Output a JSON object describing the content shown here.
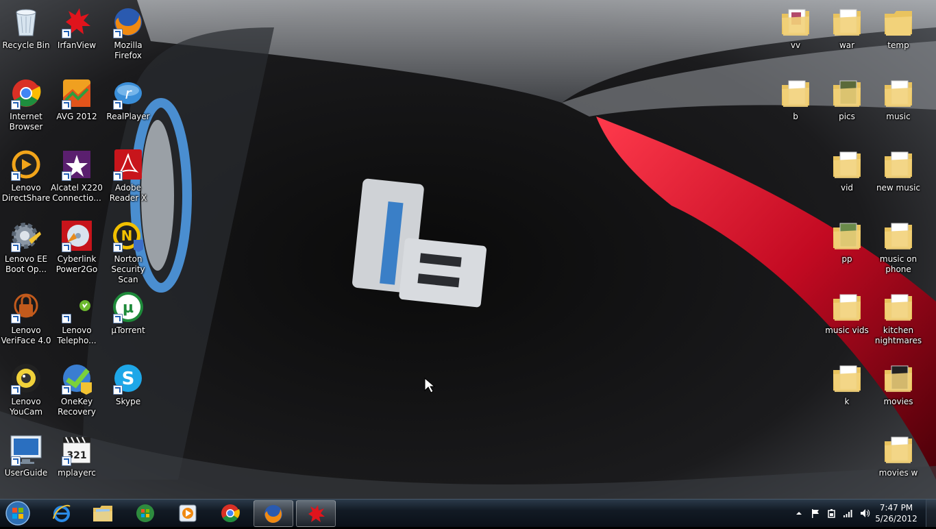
{
  "desktop": {
    "left_icons": [
      {
        "label": "Recycle Bin",
        "icon": "recycle-bin-icon"
      },
      {
        "label": "IrfanView",
        "icon": "irfanview-icon"
      },
      {
        "label": "Mozilla Firefox",
        "icon": "firefox-icon"
      },
      {
        "label": "Internet Browser",
        "icon": "chrome-icon"
      },
      {
        "label": "AVG 2012",
        "icon": "avg-icon"
      },
      {
        "label": "RealPlayer",
        "icon": "realplayer-icon"
      },
      {
        "label": "Lenovo DirectShare",
        "icon": "directshare-icon"
      },
      {
        "label": "Alcatel X220 Connectio...",
        "icon": "alcatel-icon"
      },
      {
        "label": "Adobe Reader X",
        "icon": "adobe-reader-icon"
      },
      {
        "label": "Lenovo EE Boot Op...",
        "icon": "gear-icon"
      },
      {
        "label": "Cyberlink Power2Go",
        "icon": "power2go-icon"
      },
      {
        "label": "Norton Security Scan",
        "icon": "norton-icon"
      },
      {
        "label": "Lenovo VeriFace 4.0",
        "icon": "veriface-icon"
      },
      {
        "label": "Lenovo Telepho...",
        "icon": "telephony-icon"
      },
      {
        "label": "µTorrent",
        "icon": "utorrent-icon"
      },
      {
        "label": "Lenovo YouCam",
        "icon": "webcam-icon"
      },
      {
        "label": "OneKey Recovery",
        "icon": "onekey-recovery-icon"
      },
      {
        "label": "Skype",
        "icon": "skype-icon"
      },
      {
        "label": "UserGuide",
        "icon": "lenovo-monitor-icon"
      },
      {
        "label": "mplayerc",
        "icon": "clapperboard-icon"
      }
    ],
    "right_icons": [
      {
        "label": "vv",
        "icon": "folder-icon"
      },
      {
        "label": "war",
        "icon": "folder-icon"
      },
      {
        "label": "temp",
        "icon": "folder-icon"
      },
      {
        "label": "b",
        "icon": "folder-icon"
      },
      {
        "label": "pics",
        "icon": "folder-icon"
      },
      {
        "label": "music",
        "icon": "folder-icon"
      },
      {
        "label": "vid",
        "icon": "folder-icon"
      },
      {
        "label": "new music",
        "icon": "folder-icon"
      },
      {
        "label": "pp",
        "icon": "folder-icon"
      },
      {
        "label": "music on phone",
        "icon": "folder-icon"
      },
      {
        "label": "music vids",
        "icon": "folder-icon"
      },
      {
        "label": "kitchen nightmares",
        "icon": "folder-icon"
      },
      {
        "label": "k",
        "icon": "folder-icon"
      },
      {
        "label": "movies",
        "icon": "folder-icon"
      },
      {
        "label": "movies w",
        "icon": "folder-icon"
      }
    ]
  },
  "taskbar": {
    "pinned": [
      {
        "name": "ie",
        "icon": "internet-explorer-icon",
        "active": false
      },
      {
        "name": "explorer",
        "icon": "file-explorer-icon",
        "active": false
      },
      {
        "name": "media-center",
        "icon": "windows-media-center-icon",
        "active": false
      },
      {
        "name": "media-player",
        "icon": "media-player-icon",
        "active": false
      },
      {
        "name": "chrome",
        "icon": "chrome-icon",
        "active": false
      },
      {
        "name": "firefox",
        "icon": "firefox-icon",
        "active": true
      },
      {
        "name": "irfanview",
        "icon": "irfanview-icon",
        "active": true
      }
    ],
    "tray": {
      "icons": [
        "show-hidden-icons-chevron",
        "action-center-flag-icon",
        "power-icon",
        "network-signal-icon",
        "volume-icon"
      ],
      "time": "7:47 PM",
      "date": "5/26/2012"
    }
  },
  "colors": {
    "folder": "#f2d27a",
    "taskbar": "#121a24",
    "accent_red": "#d0102a"
  }
}
